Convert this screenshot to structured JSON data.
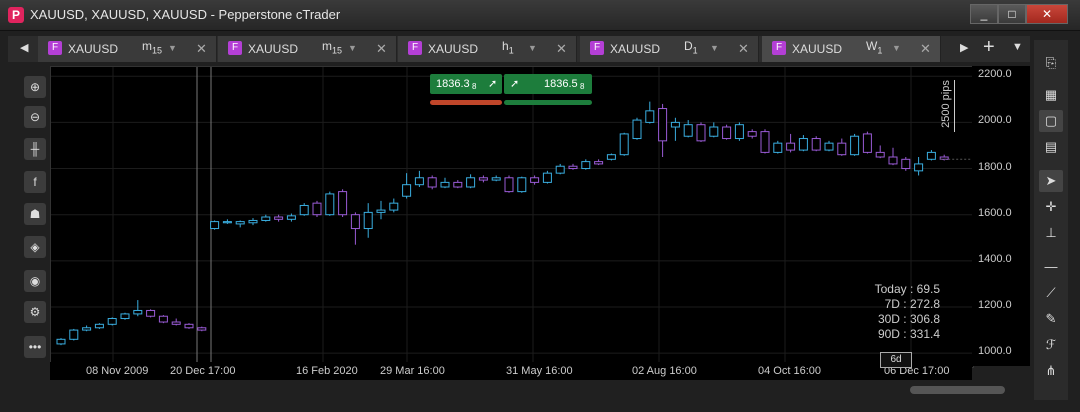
{
  "window": {
    "title": "XAUUSD, XAUUSD, XAUUSD - Pepperstone cTrader",
    "logo": "P",
    "buttons": [
      "_",
      "□",
      "✕"
    ]
  },
  "tabs": [
    {
      "symbol": "XAUUSD",
      "tf": "m",
      "tf_sub": "15"
    },
    {
      "symbol": "XAUUSD",
      "tf": "m",
      "tf_sub": "15"
    },
    {
      "symbol": "XAUUSD",
      "tf": "h",
      "tf_sub": "1"
    },
    {
      "symbol": "XAUUSD",
      "tf": "D",
      "tf_sub": "1"
    },
    {
      "symbol": "XAUUSD",
      "tf": "W",
      "tf_sub": "1"
    }
  ],
  "tab_icon_letter": "F",
  "nav": {
    "left": "◀",
    "right": "▶",
    "add": "+",
    "menu": "▼"
  },
  "price": {
    "bid": "1836.3",
    "bid_sub": "8",
    "ask": "1836.5",
    "ask_sub": "8",
    "bid_color": "#c0462a",
    "ask_color": "#1d7d3c"
  },
  "pips_label": "2500 pips",
  "y_axis": [
    {
      "label": "2200.0",
      "v": 2200
    },
    {
      "label": "2000.0",
      "v": 2000
    },
    {
      "label": "1800.0",
      "v": 1800
    },
    {
      "label": "1600.0",
      "v": 1600
    },
    {
      "label": "1400.0",
      "v": 1400
    },
    {
      "label": "1200.0",
      "v": 1200
    },
    {
      "label": "1000.0",
      "v": 1000
    }
  ],
  "x_axis": [
    "08 Nov 2009",
    "20 Dec 17:00",
    "16 Feb 2020",
    "29 Mar 16:00",
    "31 May 16:00",
    "02 Aug 16:00",
    "04 Oct 16:00",
    "06 Dec 17:00"
  ],
  "period_label": "6d",
  "stats": [
    {
      "label": "Today",
      "value": "69.5"
    },
    {
      "label": "7D",
      "value": "272.8"
    },
    {
      "label": "30D",
      "value": "306.8"
    },
    {
      "label": "90D",
      "value": "331.4"
    }
  ],
  "colors": {
    "up": "#3aaee0",
    "down": "#9a5bd6"
  },
  "chart_data": {
    "type": "candlestick",
    "ylim": [
      940,
      2240
    ],
    "candles": [
      [
        1040,
        1060,
        1035,
        1065
      ],
      [
        1060,
        1100,
        1055,
        1105
      ],
      [
        1100,
        1110,
        1095,
        1120
      ],
      [
        1110,
        1125,
        1105,
        1130
      ],
      [
        1125,
        1150,
        1120,
        1155
      ],
      [
        1150,
        1170,
        1145,
        1175
      ],
      [
        1170,
        1185,
        1160,
        1230
      ],
      [
        1185,
        1160,
        1155,
        1190
      ],
      [
        1160,
        1135,
        1130,
        1165
      ],
      [
        1135,
        1125,
        1120,
        1150
      ],
      [
        1125,
        1110,
        1105,
        1130
      ],
      [
        1110,
        1100,
        1095,
        1115
      ],
      [
        1540,
        1570,
        1535,
        1575
      ],
      [
        1565,
        1570,
        1560,
        1580
      ],
      [
        1560,
        1570,
        1545,
        1575
      ],
      [
        1565,
        1575,
        1555,
        1585
      ],
      [
        1575,
        1590,
        1570,
        1600
      ],
      [
        1590,
        1580,
        1570,
        1600
      ],
      [
        1580,
        1595,
        1570,
        1605
      ],
      [
        1600,
        1640,
        1595,
        1650
      ],
      [
        1650,
        1600,
        1590,
        1660
      ],
      [
        1600,
        1690,
        1595,
        1700
      ],
      [
        1700,
        1600,
        1590,
        1710
      ],
      [
        1600,
        1540,
        1470,
        1610
      ],
      [
        1540,
        1610,
        1500,
        1650
      ],
      [
        1610,
        1620,
        1580,
        1660
      ],
      [
        1620,
        1650,
        1610,
        1670
      ],
      [
        1680,
        1730,
        1670,
        1780
      ],
      [
        1730,
        1760,
        1720,
        1790
      ],
      [
        1760,
        1720,
        1710,
        1770
      ],
      [
        1720,
        1740,
        1715,
        1760
      ],
      [
        1740,
        1720,
        1715,
        1750
      ],
      [
        1720,
        1760,
        1715,
        1775
      ],
      [
        1760,
        1750,
        1740,
        1770
      ],
      [
        1750,
        1760,
        1745,
        1770
      ],
      [
        1760,
        1700,
        1695,
        1770
      ],
      [
        1700,
        1760,
        1695,
        1765
      ],
      [
        1760,
        1740,
        1730,
        1770
      ],
      [
        1740,
        1780,
        1735,
        1790
      ],
      [
        1780,
        1810,
        1775,
        1820
      ],
      [
        1810,
        1800,
        1795,
        1820
      ],
      [
        1800,
        1830,
        1795,
        1840
      ],
      [
        1830,
        1820,
        1815,
        1840
      ],
      [
        1840,
        1860,
        1835,
        1865
      ],
      [
        1860,
        1950,
        1855,
        1955
      ],
      [
        1930,
        2010,
        1925,
        2020
      ],
      [
        2000,
        2050,
        1995,
        2090
      ],
      [
        2060,
        1920,
        1850,
        2080
      ],
      [
        1980,
        2000,
        1920,
        2020
      ],
      [
        1940,
        1990,
        1935,
        2010
      ],
      [
        1990,
        1920,
        1915,
        2000
      ],
      [
        1940,
        1980,
        1935,
        2000
      ],
      [
        1980,
        1930,
        1925,
        1990
      ],
      [
        1930,
        1990,
        1920,
        2000
      ],
      [
        1960,
        1940,
        1930,
        1970
      ],
      [
        1960,
        1870,
        1865,
        1970
      ],
      [
        1870,
        1910,
        1865,
        1920
      ],
      [
        1910,
        1880,
        1870,
        1950
      ],
      [
        1880,
        1930,
        1875,
        1945
      ],
      [
        1930,
        1880,
        1875,
        1940
      ],
      [
        1880,
        1910,
        1875,
        1920
      ],
      [
        1910,
        1860,
        1855,
        1930
      ],
      [
        1860,
        1940,
        1855,
        1950
      ],
      [
        1950,
        1870,
        1865,
        1960
      ],
      [
        1870,
        1850,
        1845,
        1900
      ],
      [
        1850,
        1820,
        1815,
        1890
      ],
      [
        1840,
        1800,
        1790,
        1850
      ],
      [
        1790,
        1820,
        1770,
        1850
      ],
      [
        1840,
        1870,
        1835,
        1880
      ],
      [
        1850,
        1840,
        1835,
        1860
      ]
    ]
  }
}
